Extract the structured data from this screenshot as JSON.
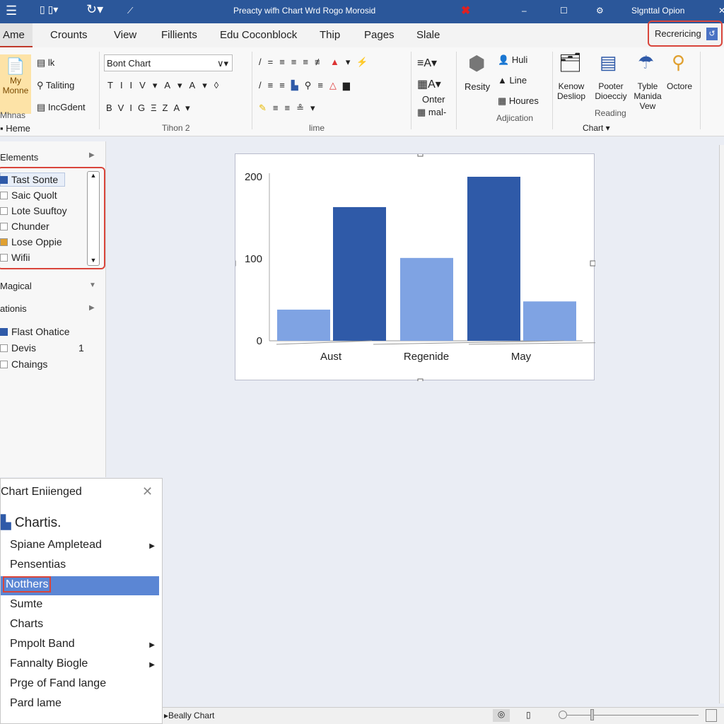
{
  "titlebar": {
    "title": "Preacty wifh Chart Wrd Rogo Morosid",
    "account": "Slgnttal Opion"
  },
  "tabs": [
    "Ame",
    "Crounts",
    "View",
    "Fillients",
    "Edu Coconblock",
    "Thip",
    "Pages",
    "Slale"
  ],
  "tab_search": "Recrericing",
  "ribbon": {
    "my_mone": "My Monne",
    "items_col": [
      "lk",
      "Taliting",
      "IncGdent"
    ],
    "mhnas": "Mhnas",
    "home": "Heme",
    "font_name": "Bont Chart",
    "font_group": "Tihon 2",
    "para_group": "lime",
    "onter": "Onter",
    "mal": "mal-",
    "resity": "Resity",
    "huli": "Huli",
    "line": "Line",
    "houres": "Houres",
    "adjication": "Adjication",
    "kenow": "Kenow Desliop",
    "pooter": "Pooter Dioecciy",
    "tyble": "Tyble Manida Vew",
    "octore": "Octore",
    "reading": "Reading",
    "chart": "Chart"
  },
  "leftpane": {
    "elements": "Elements",
    "list": [
      "Tast Sonte",
      "Saic Quolt",
      "Lote Suuftoy",
      "Chunder",
      "Lose Oppie",
      "Wifii"
    ],
    "magical": "Magical",
    "ationis": "ationis",
    "checks": [
      {
        "label": "Flast Ohatice",
        "checked": true
      },
      {
        "label": "Devis",
        "count": "1",
        "checked": false
      },
      {
        "label": "Chaings",
        "checked": false
      }
    ]
  },
  "chart_data": {
    "type": "bar",
    "categories": [
      "Aust",
      "Regenide",
      "May"
    ],
    "series": [
      {
        "values": [
          38,
          101,
          48
        ],
        "color": "#7fa3e3"
      },
      {
        "values": [
          163,
          null,
          200
        ],
        "color": "#2f5aa8"
      }
    ],
    "yticks": [
      0,
      100,
      200
    ],
    "ylim": [
      0,
      200
    ],
    "grid": false
  },
  "menu": {
    "title": "Chart Eniienged",
    "header": "Chartis.",
    "items": [
      {
        "label": "Spiane Ampletead",
        "sub": true
      },
      {
        "label": "Pensentias"
      },
      {
        "label": "Notthers",
        "selected": true
      },
      {
        "label": "Sumte"
      },
      {
        "label": "Charts"
      },
      {
        "label": "Pmpolt Band",
        "sub": true
      },
      {
        "label": "Fannalty Biogle",
        "sub": true
      },
      {
        "label": "Prge of Fand lange"
      },
      {
        "label": "Pard lame"
      }
    ]
  },
  "status": {
    "label": "Beally Chart"
  }
}
